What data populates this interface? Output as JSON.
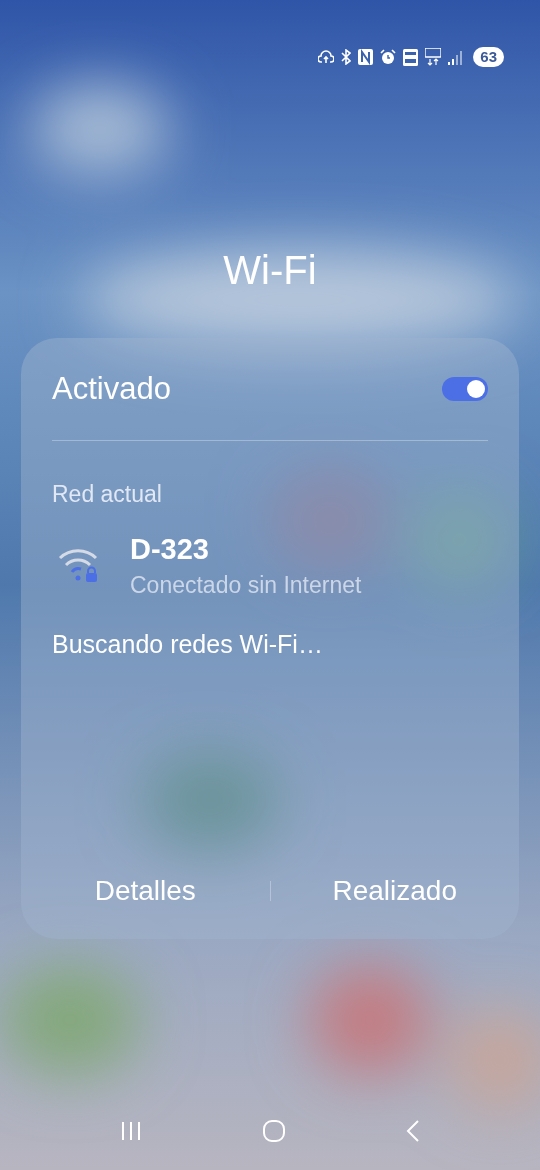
{
  "status_bar": {
    "battery": "63"
  },
  "title": "Wi-Fi",
  "panel": {
    "toggle": {
      "label": "Activado",
      "on": true
    },
    "section_label": "Red actual",
    "current_network": {
      "name": "D-323",
      "status": "Conectado sin Internet"
    },
    "scanning": "Buscando redes Wi-Fi…",
    "buttons": [
      {
        "label": "Detalles"
      },
      {
        "label": "Realizado"
      }
    ]
  }
}
